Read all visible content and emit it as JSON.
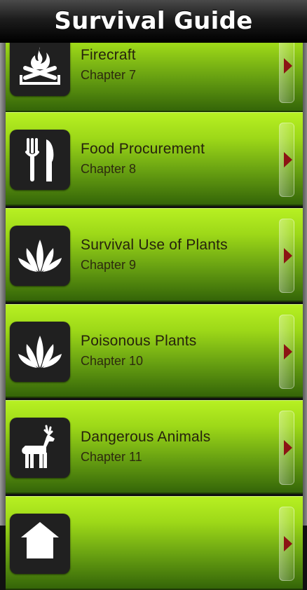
{
  "header": {
    "title": "Survival Guide"
  },
  "chapters": [
    {
      "title": "Firecraft",
      "subtitle": "Chapter 7",
      "icon": "fire-icon"
    },
    {
      "title": "Food Procurement",
      "subtitle": "Chapter 8",
      "icon": "fork-knife-icon"
    },
    {
      "title": "Survival Use of Plants",
      "subtitle": "Chapter 9",
      "icon": "plant-icon"
    },
    {
      "title": "Poisonous Plants",
      "subtitle": "Chapter 10",
      "icon": "plant-icon"
    },
    {
      "title": "Dangerous Animals",
      "subtitle": "Chapter 11",
      "icon": "deer-icon"
    },
    {
      "title": "",
      "subtitle": "",
      "icon": "house-icon"
    }
  ],
  "colors": {
    "row_green": "#9dd818",
    "chevron": "#8b1414",
    "header": "#000000"
  }
}
